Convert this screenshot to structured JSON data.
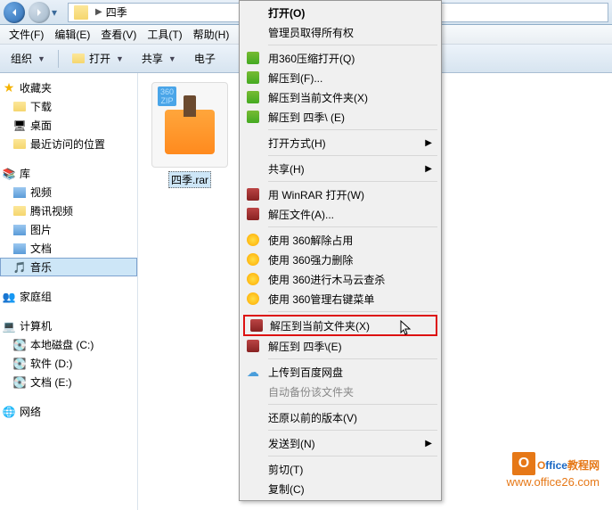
{
  "address": {
    "folder": "四季"
  },
  "menubar": [
    "文件(F)",
    "编辑(E)",
    "查看(V)",
    "工具(T)",
    "帮助(H)"
  ],
  "toolbar": {
    "organize": "组织",
    "open": "打开",
    "share": "共享",
    "email": "电子"
  },
  "sidebar": {
    "favorites": {
      "label": "收藏夹",
      "items": [
        "下载",
        "桌面",
        "最近访问的位置"
      ]
    },
    "libraries": {
      "label": "库",
      "items": [
        "视频",
        "腾讯视频",
        "图片",
        "文档",
        "音乐"
      ]
    },
    "homegroup": {
      "label": "家庭组"
    },
    "computer": {
      "label": "计算机",
      "items": [
        "本地磁盘 (C:)",
        "软件 (D:)",
        "文档 (E:)"
      ]
    },
    "network": {
      "label": "网络"
    }
  },
  "file": {
    "name": "四季.rar",
    "ziplabel": "360\nZIP"
  },
  "context": {
    "open": "打开(O)",
    "admin": "管理员取得所有权",
    "zip360": "用360压缩打开(Q)",
    "extractTo": "解压到(F)...",
    "extractHere": "解压到当前文件夹(X)",
    "extractSiji": "解压到 四季\\ (E)",
    "openWith": "打开方式(H)",
    "shareWith": "共享(H)",
    "winrarOpen": "用 WinRAR 打开(W)",
    "extractFiles": "解压文件(A)...",
    "360unlock": "使用 360解除占用",
    "360force": "使用 360强力删除",
    "360trojan": "使用 360进行木马云查杀",
    "360menu": "使用 360管理右键菜单",
    "rarExtractHere": "解压到当前文件夹(X)",
    "rarExtractSiji": "解压到 四季\\(E)",
    "baidu": "上传到百度网盘",
    "autobackup": "自动备份该文件夹",
    "restore": "还原以前的版本(V)",
    "sendTo": "发送到(N)",
    "cut": "剪切(T)",
    "copy": "复制(C)"
  },
  "watermark": {
    "brand1": "O",
    "brand2": "ffice",
    "brand3": "教程网",
    "url": "www.office26.com"
  }
}
